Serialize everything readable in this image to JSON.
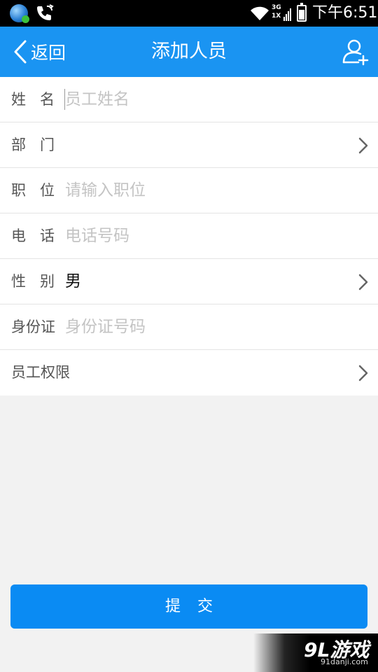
{
  "status_bar": {
    "network_top": "3G",
    "network_bottom": "1X",
    "time": "下午6:51"
  },
  "nav": {
    "back_label": "返回",
    "title": "添加人员"
  },
  "form": {
    "rows": [
      {
        "label": "姓名",
        "placeholder": "员工姓名",
        "value": ""
      },
      {
        "label": "部门",
        "value": ""
      },
      {
        "label": "职位",
        "placeholder": "请输入职位",
        "value": ""
      },
      {
        "label": "电话",
        "placeholder": "电话号码",
        "value": ""
      },
      {
        "label": "性别",
        "value": "男"
      },
      {
        "label": "身份证",
        "placeholder": "身份证号码",
        "value": ""
      },
      {
        "label": "员工权限",
        "value": ""
      }
    ]
  },
  "submit_label": "提交",
  "watermark": {
    "logo": "9L游戏",
    "url": "91danji.com"
  },
  "colors": {
    "nav_bg": "#1a94f2",
    "submit_bg": "#0a8bf3",
    "page_bg": "#f2f2f2",
    "placeholder": "#c4c4c4"
  }
}
